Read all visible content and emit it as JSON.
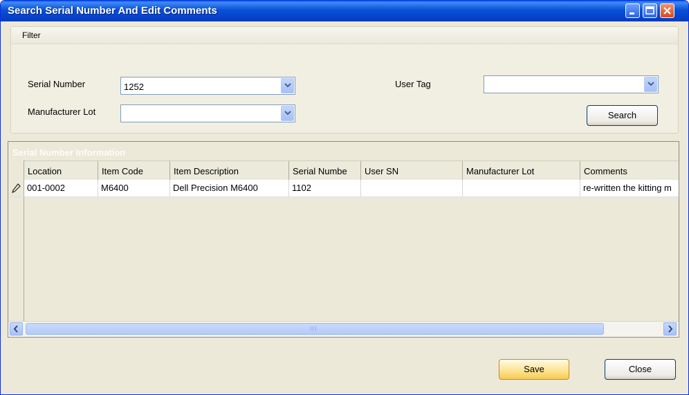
{
  "window": {
    "title": "Search Serial Number And Edit Comments"
  },
  "filter": {
    "title": "Filter",
    "serial_number_label": "Serial Number",
    "serial_number_value": "1252",
    "manufacturer_lot_label": "Manufacturer Lot",
    "manufacturer_lot_value": "",
    "user_tag_label": "User Tag",
    "user_tag_value": "",
    "search_label": "Search"
  },
  "grid": {
    "caption": "Serial Number Information",
    "columns": [
      "Location",
      "Item Code",
      "Item Description",
      "Serial Numbe",
      "User SN",
      "Manufacturer Lot",
      "Comments"
    ],
    "rows": [
      [
        "001-0002",
        "M6400",
        "Dell Precision M6400",
        "1102",
        "",
        "",
        "re-written the kitting m"
      ]
    ],
    "scroll_thumb_glyph": "III"
  },
  "footer": {
    "save_label": "Save",
    "close_label": "Close"
  },
  "colors": {
    "titlebar": "#0a4fd8",
    "save_button": "#fde28c",
    "window_bg": "#ece9d8"
  }
}
